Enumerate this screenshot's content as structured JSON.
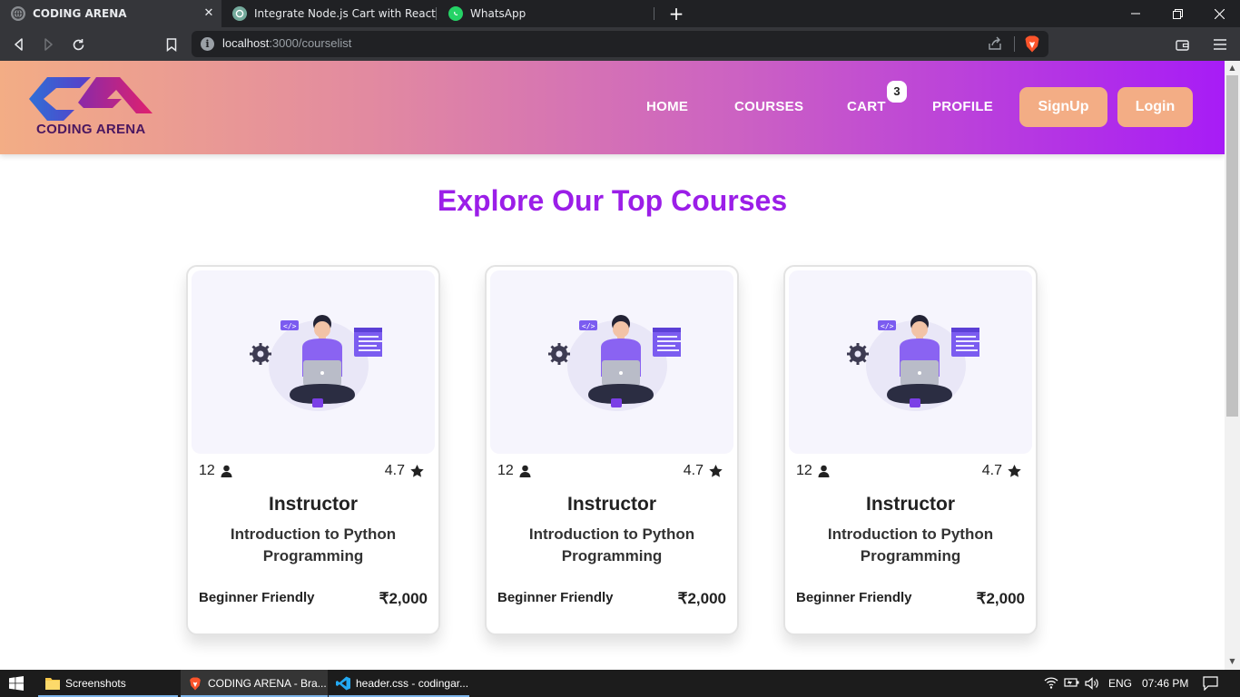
{
  "browser": {
    "tabs": [
      {
        "title": "CODING ARENA",
        "active": true
      },
      {
        "title": "Integrate Node.js Cart with React",
        "active": false
      },
      {
        "title": "WhatsApp",
        "active": false
      }
    ],
    "url_host": "localhost",
    "url_path": ":3000/courselist"
  },
  "site": {
    "logo_text": "CODING ARENA",
    "nav": {
      "home": "HOME",
      "courses": "COURSES",
      "cart": "CART",
      "cart_count": "3",
      "profile": "PROFILE"
    },
    "signup_label": "SignUp",
    "login_label": "Login",
    "section_title": "Explore Our Top Courses",
    "courses": [
      {
        "students": "12",
        "rating": "4.7",
        "instructor": "Instructor",
        "title": "Introduction to Python Programming",
        "level": "Beginner Friendly",
        "price": "₹2,000"
      },
      {
        "students": "12",
        "rating": "4.7",
        "instructor": "Instructor",
        "title": "Introduction to Python Programming",
        "level": "Beginner Friendly",
        "price": "₹2,000"
      },
      {
        "students": "12",
        "rating": "4.7",
        "instructor": "Instructor",
        "title": "Introduction to Python Programming",
        "level": "Beginner Friendly",
        "price": "₹2,000"
      }
    ],
    "colors": {
      "header_gradient_start": "#f3ad85",
      "header_gradient_end": "#a71cf6",
      "accent_purple": "#9b1ee8",
      "button_peach": "#f3ad85"
    }
  },
  "taskbar": {
    "items": [
      {
        "label": "Screenshots"
      },
      {
        "label": "CODING ARENA - Bra..."
      },
      {
        "label": "header.css - codingar..."
      }
    ],
    "language": "ENG",
    "time": "07:46 PM"
  }
}
